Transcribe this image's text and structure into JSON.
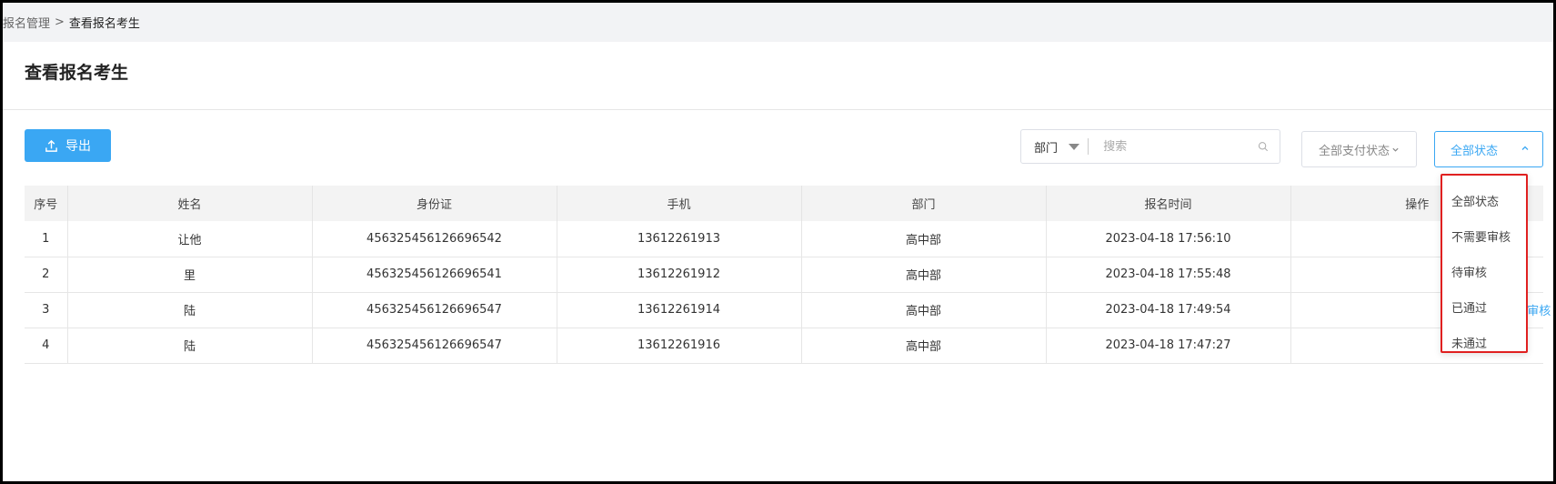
{
  "breadcrumb": {
    "parent": "报名管理",
    "separator": ">",
    "current": "查看报名考生"
  },
  "page_title": "查看报名考生",
  "toolbar": {
    "export_label": "导出",
    "dept_select_value": "部门",
    "search_placeholder": "搜索",
    "pay_status_value": "全部支付状态",
    "status_value": "全部状态"
  },
  "table": {
    "headers": [
      "序号",
      "姓名",
      "身份证",
      "手机",
      "部门",
      "报名时间",
      "操作"
    ],
    "rows": [
      {
        "idx": "1",
        "name": "让他",
        "id_card": "456325456126696542",
        "phone": "13612261913",
        "dept": "高中部",
        "time": "2023-04-18 17:56:10",
        "action": ""
      },
      {
        "idx": "2",
        "name": "里",
        "id_card": "456325456126696541",
        "phone": "13612261912",
        "dept": "高中部",
        "time": "2023-04-18 17:55:48",
        "action": ""
      },
      {
        "idx": "3",
        "name": "陆",
        "id_card": "456325456126696547",
        "phone": "13612261914",
        "dept": "高中部",
        "time": "2023-04-18 17:49:54",
        "action": "审核"
      },
      {
        "idx": "4",
        "name": "陆",
        "id_card": "456325456126696547",
        "phone": "13612261916",
        "dept": "高中部",
        "time": "2023-04-18 17:47:27",
        "action": ""
      }
    ]
  },
  "status_dropdown": {
    "options": [
      "全部状态",
      "不需要审核",
      "待审核",
      "已通过",
      "未通过"
    ]
  },
  "colors": {
    "accent": "#3aa7f3",
    "highlight_border": "#e02020"
  },
  "icons": {
    "export": "upload-icon",
    "search": "search-icon",
    "dept_caret": "caret-down-icon",
    "status_chevron": "chevron-up-icon"
  }
}
